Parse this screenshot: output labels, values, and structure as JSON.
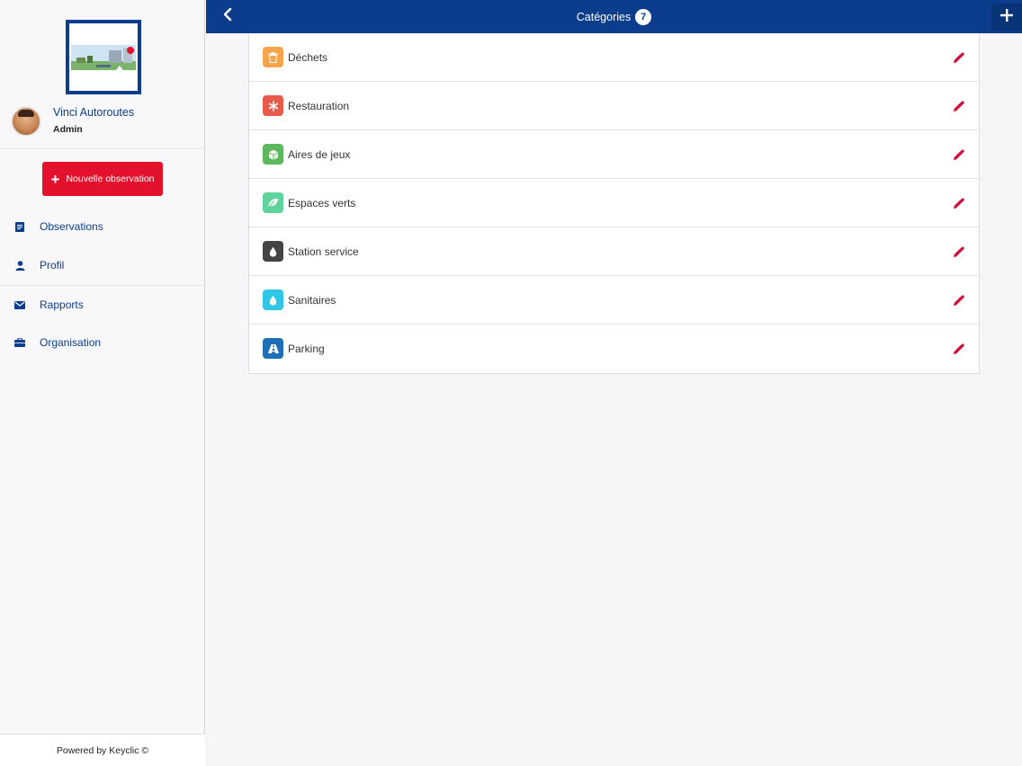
{
  "sidebar": {
    "user": {
      "name": "Vinci Autoroutes",
      "role": "Admin"
    },
    "new_observation_label": "Nouvelle observation",
    "nav": [
      {
        "label": "Observations",
        "icon": "document-icon"
      },
      {
        "label": "Profil",
        "icon": "user-icon"
      },
      {
        "label": "Rapports",
        "icon": "envelope-icon"
      },
      {
        "label": "Organisation",
        "icon": "briefcase-icon"
      }
    ],
    "footer": "Powered by Keyclic ©"
  },
  "header": {
    "title": "Catégories",
    "count": "7"
  },
  "categories": [
    {
      "label": "Déchets",
      "icon": "trash-icon",
      "color": "#f6a54c"
    },
    {
      "label": "Restauration",
      "icon": "cutlery-icon",
      "color": "#e85a4a"
    },
    {
      "label": "Aires de jeux",
      "icon": "cube-icon",
      "color": "#5cb85c"
    },
    {
      "label": "Espaces verts",
      "icon": "leaf-icon",
      "color": "#5fd49a"
    },
    {
      "label": "Station service",
      "icon": "drop-icon",
      "color": "#444444"
    },
    {
      "label": "Sanitaires",
      "icon": "water-drop-icon",
      "color": "#2fc6e8"
    },
    {
      "label": "Parking",
      "icon": "road-icon",
      "color": "#1f6fb8"
    }
  ],
  "colors": {
    "brand_blue": "#0b3d8c",
    "accent_red": "#e3112c",
    "edit_icon": "#d0103a"
  }
}
